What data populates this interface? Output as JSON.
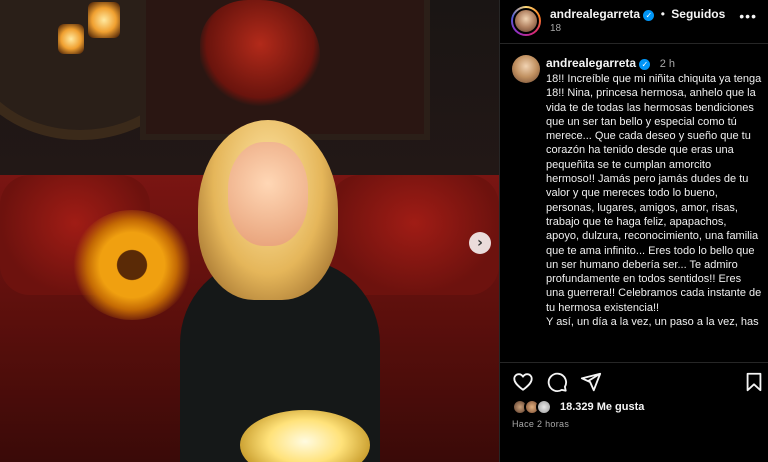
{
  "post": {
    "account": {
      "username": "andrealegarreta",
      "verified": true,
      "follow_status": "Seguidos",
      "subtitle": "18"
    },
    "caption": {
      "username": "andrealegarreta",
      "time": "2 h",
      "paragraphs": [
        "18!! Increíble que mi niñita chiquita ya tenga 18!! Nina, princesa hermosa, anhelo que la vida te de todas las hermosas bendiciones que un ser tan bello y especial como tú merece... Que cada deseo y sueño que tu corazón ha tenido desde que eras una pequeñita se te cumplan amorcito hermoso!! Jamás pero jamás dudes de tu valor y que mereces todo lo bueno, personas, lugares, amigos, amor, risas, trabajo que te haga feliz, apapachos, apoyo, dulzura, reconocimiento, una familia que te ama infinito... Eres todo lo bello que un ser humano debería ser... Te admiro profundamente en todos sentidos!! Eres una guerrera!! Celebramos cada instante de tu hermosa existencia!!",
        "Y así, un día a la vez, un paso a la vez, has"
      ]
    },
    "likes": {
      "count_label": "18.329 Me gusta"
    },
    "time_ago": "Hace 2 horas",
    "icons": {
      "verified": "verified-badge-icon",
      "more": "more-options-icon",
      "like": "heart-icon",
      "comment": "comment-icon",
      "share": "send-icon",
      "save": "bookmark-icon",
      "carousel_next": "chevron-right-icon"
    },
    "more_glyph": "•••",
    "next_glyph": "›",
    "check_glyph": "✓"
  }
}
